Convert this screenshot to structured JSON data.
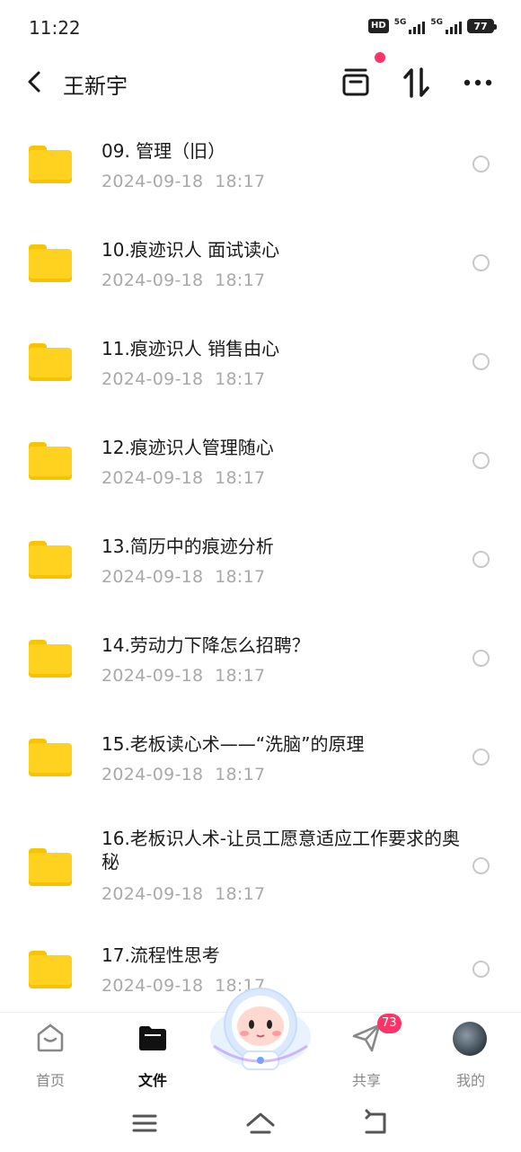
{
  "status_bar": {
    "time": "11:22",
    "hd_label": "HD",
    "sim1_label": "5G",
    "sim2_label": "5G",
    "battery": "77"
  },
  "header": {
    "title": "王新宇",
    "icons": [
      "back-icon",
      "transfer-list-icon",
      "sort-icon",
      "more-icon"
    ],
    "notification_dot_color": "#ff3366"
  },
  "files": [
    {
      "name": "09. 管理（旧）",
      "date": "2024-09-18  18:17"
    },
    {
      "name": "10.痕迹识人 面试读心",
      "date": "2024-09-18  18:17"
    },
    {
      "name": "11.痕迹识人 销售由心",
      "date": "2024-09-18  18:17"
    },
    {
      "name": "12.痕迹识人管理随心",
      "date": "2024-09-18  18:17"
    },
    {
      "name": "13.简历中的痕迹分析",
      "date": "2024-09-18  18:17"
    },
    {
      "name": "14.劳动力下降怎么招聘？",
      "date": "2024-09-18  18:17"
    },
    {
      "name": "15.老板读心术——“洗脑”的原理",
      "date": "2024-09-18  18:17"
    },
    {
      "name": "16.老板识人术-让员工愿意适应工作要求的奥秘",
      "date": "2024-09-18  18:17"
    },
    {
      "name": "17.流程性思考",
      "date": "2024-09-18  18:17"
    }
  ],
  "bottom_nav": {
    "home": "首页",
    "files": "文件",
    "share": "共享",
    "mine": "我的",
    "share_badge": "73",
    "active": "files"
  },
  "colors": {
    "folder": "#ffd21f",
    "badge": "#ff3366",
    "date_text": "#a9a9a9"
  }
}
